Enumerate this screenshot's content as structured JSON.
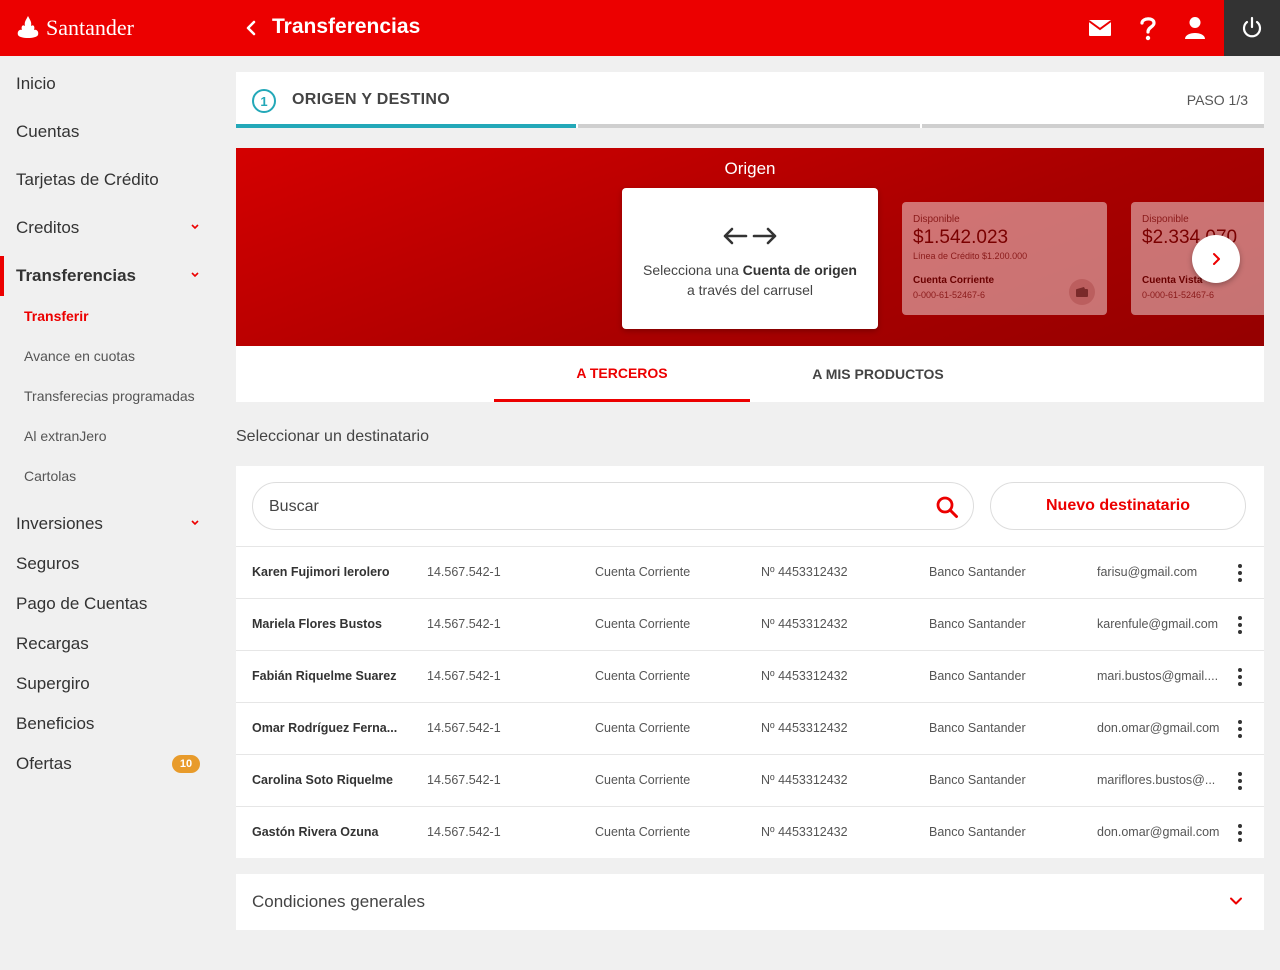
{
  "app": {
    "brand": "Santander",
    "page_title": "Transferencias"
  },
  "colors": {
    "brand_red": "#ec0000",
    "step_teal": "#23a8b8",
    "badge_orange": "#e89b2b"
  },
  "header": {
    "icons": [
      "mail-icon",
      "help-icon",
      "user-icon",
      "power-icon"
    ]
  },
  "sidebar": {
    "items": [
      {
        "label": "Inicio"
      },
      {
        "label": "Cuentas"
      },
      {
        "label": "Tarjetas de Crédito"
      },
      {
        "label": "Creditos",
        "expandable": true
      },
      {
        "label": "Transferencias",
        "expandable": true,
        "active": true
      },
      {
        "label": "Inversiones",
        "expandable": true
      },
      {
        "label": "Seguros"
      },
      {
        "label": "Pago de Cuentas"
      },
      {
        "label": "Recargas"
      },
      {
        "label": "Supergiro"
      },
      {
        "label": "Beneficios"
      },
      {
        "label": "Ofertas",
        "badge": "10"
      }
    ],
    "transfer_sub": [
      {
        "label": "Transferir",
        "active": true
      },
      {
        "label": "Avance en cuotas"
      },
      {
        "label": "Transferecias programadas"
      },
      {
        "label": "Al extranJero"
      },
      {
        "label": "Cartolas"
      }
    ]
  },
  "stepper": {
    "number": "1",
    "title": "Origen y destino",
    "count": "PASO 1/3",
    "progress_steps": 3,
    "current_step": 1
  },
  "origin": {
    "label": "Origen",
    "hint_prefix": "Selecciona una ",
    "hint_bold": "Cuenta de origen",
    "hint_suffix": " a través del carrusel",
    "accounts": [
      {
        "available_label": "Disponible",
        "amount": "$1.542.023",
        "credit_line": "Línea de Crédito $1.200.000",
        "type": "Cuenta Corriente",
        "number": "0-000-61-52467-6"
      },
      {
        "available_label": "Disponible",
        "amount": "$2.334.070",
        "type": "Cuenta Vista",
        "number": "0-000-61-52467-6"
      }
    ]
  },
  "tabs": [
    {
      "label": "A terceros",
      "active": true
    },
    {
      "label": "A mis productos",
      "active": false
    }
  ],
  "recipients": {
    "section_title": "Seleccionar un destinatario",
    "search_placeholder": "Buscar",
    "new_button": "Nuevo destinatario",
    "rows": [
      {
        "name": "Karen Fujimori Ierolero",
        "rut": "14.567.542-1",
        "account_type": "Cuenta Corriente",
        "account_number": "Nº 4453312432",
        "bank": "Banco Santander",
        "email": "farisu@gmail.com"
      },
      {
        "name": "Mariela Flores Bustos",
        "rut": "14.567.542-1",
        "account_type": "Cuenta Corriente",
        "account_number": "Nº 4453312432",
        "bank": "Banco Santander",
        "email": "karenfule@gmail.com"
      },
      {
        "name": "Fabián Riquelme Suarez",
        "rut": "14.567.542-1",
        "account_type": "Cuenta Corriente",
        "account_number": "Nº 4453312432",
        "bank": "Banco Santander",
        "email": "mari.bustos@gmail...."
      },
      {
        "name": "Omar Rodríguez Ferna...",
        "rut": "14.567.542-1",
        "account_type": "Cuenta Corriente",
        "account_number": "Nº 4453312432",
        "bank": "Banco Santander",
        "email": "don.omar@gmail.com"
      },
      {
        "name": "Carolina Soto Riquelme",
        "rut": "14.567.542-1",
        "account_type": "Cuenta Corriente",
        "account_number": "Nº 4453312432",
        "bank": "Banco Santander",
        "email": "mariflores.bustos@..."
      },
      {
        "name": "Gastón Rivera Ozuna",
        "rut": "14.567.542-1",
        "account_type": "Cuenta Corriente",
        "account_number": "Nº 4453312432",
        "bank": "Banco Santander",
        "email": "don.omar@gmail.com"
      }
    ]
  },
  "conditions": {
    "title": "Condiciones generales"
  }
}
